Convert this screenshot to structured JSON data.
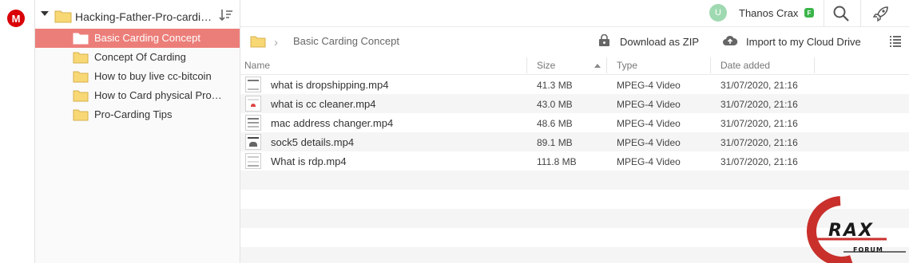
{
  "app": {
    "logo_letter": "M"
  },
  "tree": {
    "root_label": "Hacking-Father-Pro-cardin…",
    "items": [
      {
        "label": "Basic Carding Concept",
        "selected": true
      },
      {
        "label": "Concept Of Carding"
      },
      {
        "label": "How to buy live cc-bitcoin"
      },
      {
        "label": "How to Card physical Pro…"
      },
      {
        "label": "Pro-Carding Tips"
      }
    ]
  },
  "topbar": {
    "avatar_letter": "U",
    "username": "Thanos Crax",
    "badge": "F"
  },
  "pathbar": {
    "current": "Basic Carding Concept",
    "download_zip": "Download as ZIP",
    "import": "Import to my Cloud Drive"
  },
  "table": {
    "headers": {
      "name": "Name",
      "size": "Size",
      "type": "Type",
      "date": "Date added"
    },
    "rows": [
      {
        "name": "what is dropshipping.mp4",
        "size": "41.3 MB",
        "type": "MPEG-4 Video",
        "date": "31/07/2020, 21:16"
      },
      {
        "name": "what is cc cleaner.mp4",
        "size": "43.0 MB",
        "type": "MPEG-4 Video",
        "date": "31/07/2020, 21:16"
      },
      {
        "name": "mac address changer.mp4",
        "size": "48.6 MB",
        "type": "MPEG-4 Video",
        "date": "31/07/2020, 21:16"
      },
      {
        "name": "sock5 details.mp4",
        "size": "89.1 MB",
        "type": "MPEG-4 Video",
        "date": "31/07/2020, 21:16"
      },
      {
        "name": "What is rdp.mp4",
        "size": "111.8 MB",
        "type": "MPEG-4 Video",
        "date": "31/07/2020, 21:16"
      }
    ]
  },
  "watermark": {
    "text": "RAX",
    "sub": "FORUM"
  },
  "colors": {
    "brand": "#d90007",
    "selected": "#ec7e79",
    "folder": "#f8d775",
    "badge": "#3bb54a",
    "avatar": "#9fd9b1"
  }
}
